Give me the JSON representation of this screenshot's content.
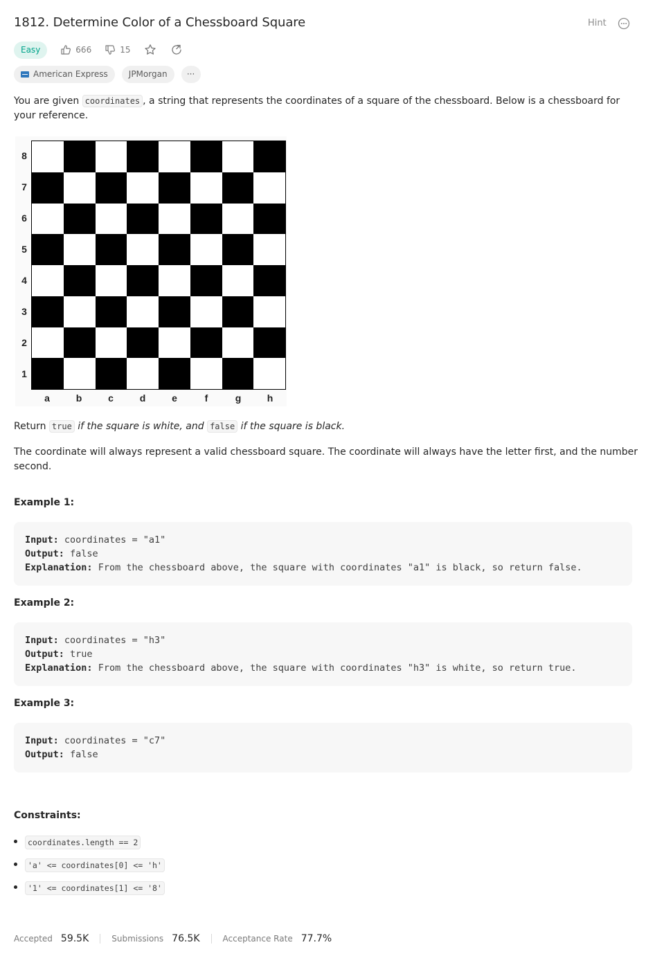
{
  "problem": {
    "title": "1812. Determine Color of a Chessboard Square",
    "hint_label": "Hint",
    "difficulty": "Easy",
    "likes": "666",
    "dislikes": "15"
  },
  "tags": {
    "companies": [
      "American Express",
      "JPMorgan"
    ],
    "more_label": "···"
  },
  "description": {
    "p1_before": "You are given ",
    "p1_code": "coordinates",
    "p1_after": ", a string that represents the coordinates of a square of the chessboard. Below is a chessboard for your reference.",
    "p2_return": "Return ",
    "p2_true": "true",
    "p2_mid": " if the square is white, and ",
    "p2_false": "false",
    "p2_end": " if the square is black.",
    "p3": "The coordinate will always represent a valid chessboard square. The coordinate will always have the letter first, and the number second."
  },
  "chessboard": {
    "ranks": [
      "8",
      "7",
      "6",
      "5",
      "4",
      "3",
      "2",
      "1"
    ],
    "files": [
      "a",
      "b",
      "c",
      "d",
      "e",
      "f",
      "g",
      "h"
    ]
  },
  "examples": [
    {
      "title": "Example 1:",
      "input_label": "Input:",
      "input": "coordinates = \"a1\"",
      "output_label": "Output:",
      "output": "false",
      "explanation_label": "Explanation:",
      "explanation": "From the chessboard above, the square with coordinates \"a1\" is black, so return false."
    },
    {
      "title": "Example 2:",
      "input_label": "Input:",
      "input": "coordinates = \"h3\"",
      "output_label": "Output:",
      "output": "true",
      "explanation_label": "Explanation:",
      "explanation": "From the chessboard above, the square with coordinates \"h3\" is white, so return true."
    },
    {
      "title": "Example 3:",
      "input_label": "Input:",
      "input": "coordinates = \"c7\"",
      "output_label": "Output:",
      "output": "false"
    }
  ],
  "constraints": {
    "title": "Constraints:",
    "items": [
      "coordinates.length == 2",
      "'a' <= coordinates[0] <= 'h'",
      "'1' <= coordinates[1] <= '8'"
    ]
  },
  "stats": {
    "accepted_label": "Accepted",
    "accepted": "59.5K",
    "submissions_label": "Submissions",
    "submissions": "76.5K",
    "rate_label": "Acceptance Rate",
    "rate": "77.7%"
  },
  "colors": {
    "easy_text": "#00a38a",
    "easy_bg": "#dff4ef",
    "code_bg": "#f7f7f7"
  }
}
